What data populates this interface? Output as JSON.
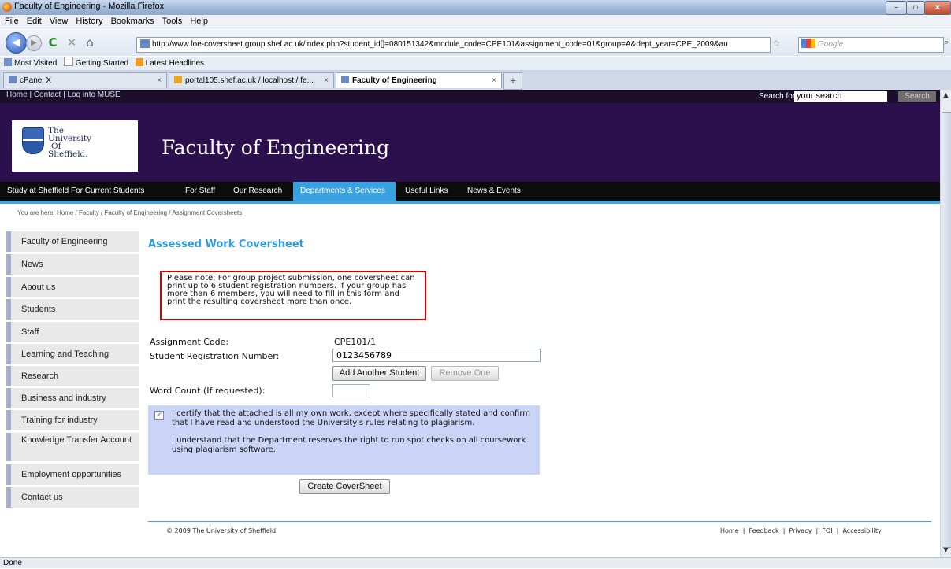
{
  "window": {
    "title": "Faculty of Engineering - Mozilla Firefox"
  },
  "menubar": [
    "File",
    "Edit",
    "View",
    "History",
    "Bookmarks",
    "Tools",
    "Help"
  ],
  "browser": {
    "url": "http://www.foe-coversheet.group.shef.ac.uk/index.php?student_id[]=080151342&module_code=CPE101&assignment_code=01&group=A&dept_year=CPE_2009&au",
    "search_placeholder": "Google"
  },
  "bookmarks": [
    "Most Visited",
    "Getting Started",
    "Latest Headlines"
  ],
  "tabs": [
    {
      "label": "cPanel X"
    },
    {
      "label": "portal105.shef.ac.uk / localhost / fe..."
    },
    {
      "label": "Faculty of Engineering"
    }
  ],
  "status": "Done",
  "page": {
    "top_links": "Home | Contact | Log into MUSE",
    "search_label": "Search for",
    "search_value": "your search",
    "search_button": "Search",
    "university_name": [
      "The",
      "University",
      "Of",
      "Sheffield."
    ],
    "faculty_title": "Faculty of Engineering",
    "nav": [
      "Study at Sheffield",
      "For Current Students",
      "For Staff",
      "Our Research",
      "Departments & Services",
      "Useful Links",
      "News & Events"
    ],
    "nav_active": "Departments & Services",
    "breadcrumb": {
      "prefix": "You are here:",
      "items": [
        "Home",
        "Faculty",
        "Faculty of Engineering",
        "Assignment Coversheets"
      ]
    },
    "sidebar": [
      "Faculty of Engineering",
      "News",
      "About us",
      "Students",
      "Staff",
      "Learning and Teaching",
      "Research",
      "Business and industry",
      "Training for industry",
      "Knowledge Transfer Account",
      "Employment opportunities",
      "Contact us"
    ],
    "form": {
      "heading": "Assessed Work Coversheet",
      "note": "Please note: For group project submission, one coversheet can print up to 6 student registration numbers. If your group has more than 6 members, you will need to fill in this form and print the resulting coversheet more than once.",
      "assignment_code_label": "Assignment Code:",
      "assignment_code_value": "CPE101/1",
      "reg_label": "Student Registration Number:",
      "reg_value": "0123456789",
      "add_button": "Add Another Student",
      "remove_button": "Remove One",
      "word_count_label": "Word Count (If requested):",
      "word_count_value": "",
      "certify_checked": true,
      "certify_text_1": "I certify that the attached is all my own work, except where specifically stated and confirm that I have read and understood the University's rules relating to plagiarism.",
      "certify_text_2": "I understand that the Department reserves the right to run spot checks on all coursework using plagiarism software.",
      "create_button": "Create CoverSheet"
    },
    "footer": {
      "copyright": "© 2009 The University of Sheffield",
      "links": [
        "Home",
        "Feedback",
        "Privacy",
        "FOI",
        "Accessibility"
      ]
    }
  },
  "colors": {
    "purple": "#2c0f4d",
    "accent_blue": "#3aa1e0",
    "note_border": "#d60000",
    "certify_bg": "#c9d4f7"
  }
}
